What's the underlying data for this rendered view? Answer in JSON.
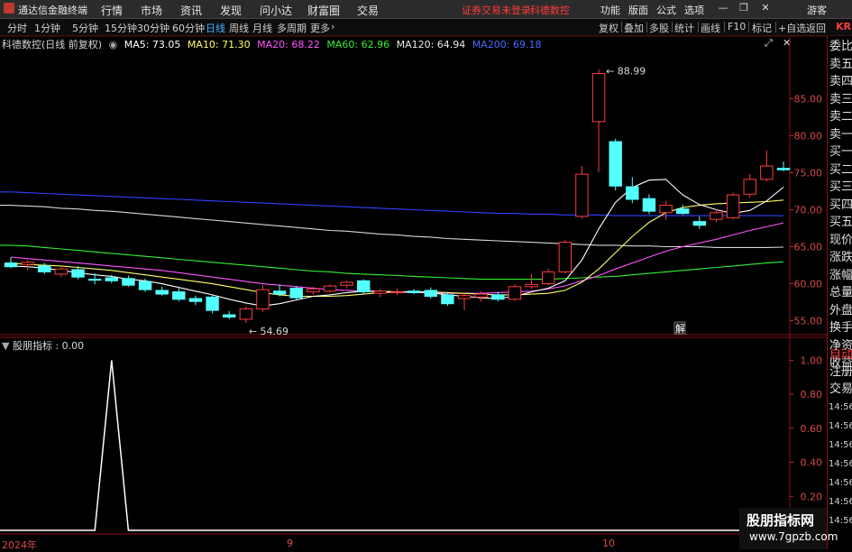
{
  "app": {
    "title": "通达信金融终端",
    "notice": "证券交易未登录",
    "stock_link": "科德数控",
    "guest": "游客"
  },
  "menu": [
    "行情",
    "市场",
    "资讯",
    "发现",
    "问小达",
    "财富圈",
    "交易"
  ],
  "right_menu": [
    "功能",
    "版面",
    "公式",
    "选项"
  ],
  "window_controls": [
    "minimize-icon",
    "restore-icon",
    "close-icon"
  ],
  "periods": {
    "items": [
      "分时",
      "1分钟",
      "5分钟",
      "15分钟",
      "30分钟",
      "60分钟",
      "日线",
      "周线",
      "月线",
      "多周期",
      "更多"
    ],
    "active": "日线"
  },
  "toolbar": [
    "复权",
    "叠加",
    "多股",
    "统计",
    "画线",
    "F10",
    "标记",
    "+自选",
    "返回"
  ],
  "main_chart": {
    "stock_label": "科德数控(日线 前复权)",
    "ma_legend": [
      {
        "label": "MA5: 73.05",
        "color": "#ffffff"
      },
      {
        "label": "MA10: 71.30",
        "color": "#ffff66"
      },
      {
        "label": "MA20: 68.22",
        "color": "#ff55ff"
      },
      {
        "label": "MA60: 62.96",
        "color": "#33ee33"
      },
      {
        "label": "MA120: 64.94",
        "color": "#e8e8e8"
      },
      {
        "label": "MA200: 69.18",
        "color": "#4a6cff"
      }
    ],
    "high_label": "88.99",
    "low_label": "54.69",
    "marker": "解"
  },
  "sub_chart": {
    "title": "股朋指标 : 0.00"
  },
  "right_panel": {
    "items": [
      "委比",
      "卖五",
      "卖四",
      "卖三",
      "卖二",
      "卖一",
      "买一",
      "买二",
      "买三",
      "买四",
      "买五",
      "现价",
      "涨跌",
      "涨幅",
      "总量",
      "外盘",
      "换手",
      "净资",
      "收益"
    ],
    "items2": [
      "自动",
      "注册",
      "交易"
    ],
    "times": [
      "14:56",
      "14:56",
      "14:56",
      "14:56",
      "14:56",
      "14:56",
      "14:56"
    ],
    "code_hint": "KR"
  },
  "x_axis": [
    "2024年",
    "9",
    "10"
  ],
  "watermark": {
    "line1": "股朋指标网",
    "line2": "www.7gpzb.com"
  },
  "chart_data": [
    {
      "type": "candlestick",
      "ylim": [
        53,
        92
      ],
      "y_ticks": [
        55,
        60,
        65,
        70,
        75,
        80,
        85
      ],
      "candles": [
        {
          "o": 62.8,
          "h": 63.6,
          "l": 62.1,
          "c": 62.3
        },
        {
          "o": 62.6,
          "h": 63.2,
          "l": 61.8,
          "c": 62.9
        },
        {
          "o": 62.4,
          "h": 62.8,
          "l": 61.3,
          "c": 61.6
        },
        {
          "o": 61.3,
          "h": 62.2,
          "l": 60.9,
          "c": 62.0
        },
        {
          "o": 61.9,
          "h": 62.4,
          "l": 60.6,
          "c": 60.9
        },
        {
          "o": 60.6,
          "h": 61.4,
          "l": 59.9,
          "c": 60.5
        },
        {
          "o": 60.8,
          "h": 61.2,
          "l": 60.1,
          "c": 60.4
        },
        {
          "o": 60.7,
          "h": 61.1,
          "l": 59.6,
          "c": 59.8
        },
        {
          "o": 60.3,
          "h": 60.7,
          "l": 58.9,
          "c": 59.2
        },
        {
          "o": 59.1,
          "h": 59.6,
          "l": 58.4,
          "c": 58.6
        },
        {
          "o": 58.9,
          "h": 59.4,
          "l": 57.6,
          "c": 57.9
        },
        {
          "o": 58.0,
          "h": 58.4,
          "l": 57.1,
          "c": 57.6
        },
        {
          "o": 58.2,
          "h": 58.5,
          "l": 56.0,
          "c": 56.4
        },
        {
          "o": 55.8,
          "h": 56.3,
          "l": 55.2,
          "c": 55.5
        },
        {
          "o": 55.2,
          "h": 56.9,
          "l": 54.7,
          "c": 56.6
        },
        {
          "o": 56.6,
          "h": 59.8,
          "l": 56.2,
          "c": 59.2
        },
        {
          "o": 59.0,
          "h": 59.9,
          "l": 58.3,
          "c": 58.6
        },
        {
          "o": 59.4,
          "h": 59.7,
          "l": 57.8,
          "c": 58.1
        },
        {
          "o": 58.9,
          "h": 59.6,
          "l": 58.5,
          "c": 59.3
        },
        {
          "o": 59.0,
          "h": 59.9,
          "l": 58.8,
          "c": 59.7
        },
        {
          "o": 59.8,
          "h": 60.4,
          "l": 59.4,
          "c": 60.2
        },
        {
          "o": 60.4,
          "h": 60.6,
          "l": 58.6,
          "c": 58.9
        },
        {
          "o": 58.7,
          "h": 59.3,
          "l": 58.2,
          "c": 59.0
        },
        {
          "o": 58.9,
          "h": 59.4,
          "l": 58.5,
          "c": 58.9
        },
        {
          "o": 59.0,
          "h": 59.3,
          "l": 58.6,
          "c": 58.8
        },
        {
          "o": 59.1,
          "h": 59.5,
          "l": 58.0,
          "c": 58.3
        },
        {
          "o": 58.5,
          "h": 58.9,
          "l": 57.0,
          "c": 57.3
        },
        {
          "o": 58.0,
          "h": 58.7,
          "l": 56.4,
          "c": 58.4
        },
        {
          "o": 58.2,
          "h": 59.0,
          "l": 57.6,
          "c": 58.6
        },
        {
          "o": 58.5,
          "h": 58.9,
          "l": 57.6,
          "c": 57.9
        },
        {
          "o": 57.9,
          "h": 59.9,
          "l": 57.7,
          "c": 59.6
        },
        {
          "o": 59.6,
          "h": 61.3,
          "l": 59.3,
          "c": 59.9
        },
        {
          "o": 60.0,
          "h": 62.0,
          "l": 59.8,
          "c": 61.6
        },
        {
          "o": 61.6,
          "h": 65.9,
          "l": 61.4,
          "c": 65.6
        },
        {
          "o": 69.1,
          "h": 75.9,
          "l": 68.8,
          "c": 74.8
        },
        {
          "o": 81.9,
          "h": 88.99,
          "l": 75.1,
          "c": 88.4
        },
        {
          "o": 79.2,
          "h": 79.6,
          "l": 72.6,
          "c": 73.2
        },
        {
          "o": 73.1,
          "h": 74.4,
          "l": 70.9,
          "c": 71.4
        },
        {
          "o": 71.5,
          "h": 72.1,
          "l": 69.4,
          "c": 69.8
        },
        {
          "o": 69.6,
          "h": 71.2,
          "l": 68.6,
          "c": 70.6
        },
        {
          "o": 70.1,
          "h": 70.7,
          "l": 69.3,
          "c": 69.5
        },
        {
          "o": 68.4,
          "h": 69.1,
          "l": 67.4,
          "c": 67.9
        },
        {
          "o": 68.7,
          "h": 70.1,
          "l": 68.3,
          "c": 69.6
        },
        {
          "o": 68.9,
          "h": 72.3,
          "l": 68.7,
          "c": 72.0
        },
        {
          "o": 72.1,
          "h": 74.8,
          "l": 71.6,
          "c": 74.1
        },
        {
          "o": 74.1,
          "h": 78.0,
          "l": 73.8,
          "c": 75.9
        },
        {
          "o": 75.6,
          "h": 76.5,
          "l": 75.2,
          "c": 75.4
        }
      ],
      "ma_series": [
        {
          "name": "MA5",
          "values": [
            62.4,
            62.3,
            62.1,
            61.8,
            61.5,
            61.2,
            61.0,
            60.6,
            60.4,
            60.0,
            59.5,
            59.0,
            58.5,
            57.9,
            57.4,
            57.0,
            57.3,
            57.8,
            58.3,
            58.5,
            58.8,
            59.0,
            59.0,
            58.9,
            58.9,
            58.8,
            58.5,
            58.3,
            58.1,
            58.0,
            58.3,
            58.9,
            59.4,
            60.4,
            63.2,
            67.4,
            71.0,
            73.0,
            74.0,
            74.1,
            72.0,
            70.7,
            70.0,
            69.5,
            69.9,
            71.2,
            73.05
          ]
        },
        {
          "name": "MA10",
          "values": [
            62.8,
            62.6,
            62.5,
            62.4,
            62.2,
            62.0,
            61.8,
            61.5,
            61.2,
            60.9,
            60.6,
            60.3,
            60.0,
            59.6,
            59.2,
            58.8,
            58.5,
            58.3,
            58.3,
            58.3,
            58.4,
            58.6,
            58.8,
            58.9,
            58.9,
            58.9,
            58.8,
            58.7,
            58.6,
            58.5,
            58.5,
            58.6,
            58.7,
            59.1,
            60.2,
            62.0,
            64.2,
            66.4,
            68.3,
            69.6,
            70.3,
            70.6,
            70.8,
            70.9,
            71.0,
            71.1,
            71.3
          ]
        },
        {
          "name": "MA20",
          "values": [
            63.6,
            63.4,
            63.2,
            63.0,
            62.8,
            62.6,
            62.4,
            62.2,
            62.0,
            61.8,
            61.5,
            61.2,
            60.9,
            60.6,
            60.3,
            60.0,
            59.8,
            59.6,
            59.4,
            59.2,
            59.1,
            59.0,
            58.9,
            58.9,
            58.8,
            58.8,
            58.7,
            58.7,
            58.7,
            58.8,
            58.9,
            59.0,
            59.3,
            59.7,
            60.4,
            61.1,
            62.0,
            62.8,
            63.6,
            64.4,
            65.0,
            65.5,
            66.0,
            66.6,
            67.2,
            67.7,
            68.22
          ]
        },
        {
          "name": "MA60",
          "values": [
            65.2,
            65.1,
            64.9,
            64.7,
            64.5,
            64.3,
            64.1,
            63.9,
            63.7,
            63.5,
            63.3,
            63.1,
            62.9,
            62.7,
            62.5,
            62.3,
            62.1,
            61.9,
            61.7,
            61.6,
            61.4,
            61.3,
            61.2,
            61.1,
            61.0,
            60.9,
            60.8,
            60.7,
            60.6,
            60.6,
            60.6,
            60.6,
            60.6,
            60.7,
            60.8,
            60.9,
            61.0,
            61.2,
            61.4,
            61.6,
            61.8,
            62.0,
            62.2,
            62.4,
            62.6,
            62.8,
            62.96
          ]
        },
        {
          "name": "MA120",
          "values": [
            70.6,
            70.5,
            70.4,
            70.2,
            70.1,
            69.9,
            69.8,
            69.6,
            69.4,
            69.2,
            69.0,
            68.8,
            68.6,
            68.4,
            68.2,
            68.0,
            67.8,
            67.6,
            67.4,
            67.2,
            67.1,
            66.9,
            66.7,
            66.6,
            66.4,
            66.3,
            66.1,
            66.0,
            65.9,
            65.8,
            65.7,
            65.6,
            65.5,
            65.4,
            65.3,
            65.2,
            65.2,
            65.1,
            65.1,
            65.0,
            65.0,
            65.0,
            64.9,
            64.9,
            64.9,
            64.9,
            64.94
          ]
        },
        {
          "name": "MA200",
          "values": [
            72.4,
            72.3,
            72.2,
            72.1,
            72.0,
            71.9,
            71.8,
            71.7,
            71.6,
            71.5,
            71.4,
            71.3,
            71.2,
            71.1,
            71.0,
            70.9,
            70.8,
            70.7,
            70.6,
            70.5,
            70.4,
            70.3,
            70.2,
            70.1,
            70.0,
            69.9,
            69.8,
            69.7,
            69.6,
            69.5,
            69.5,
            69.4,
            69.4,
            69.3,
            69.3,
            69.3,
            69.2,
            69.2,
            69.2,
            69.2,
            69.2,
            69.2,
            69.2,
            69.2,
            69.2,
            69.2,
            69.18
          ]
        }
      ]
    },
    {
      "type": "line",
      "name": "股朋指标",
      "ylim": [
        0,
        1.05
      ],
      "y_ticks": [
        0.2,
        0.4,
        0.6,
        0.8,
        1.0
      ],
      "values": [
        0,
        0,
        0,
        0,
        0,
        0,
        1,
        0,
        0,
        0,
        0,
        0,
        0,
        0,
        0,
        0,
        0,
        0,
        0,
        0,
        0,
        0,
        0,
        0,
        0,
        0,
        0,
        0,
        0,
        0,
        0,
        0,
        0,
        0,
        0,
        0,
        0,
        0,
        0,
        0,
        0,
        0,
        0,
        0,
        0,
        0,
        0
      ]
    }
  ]
}
